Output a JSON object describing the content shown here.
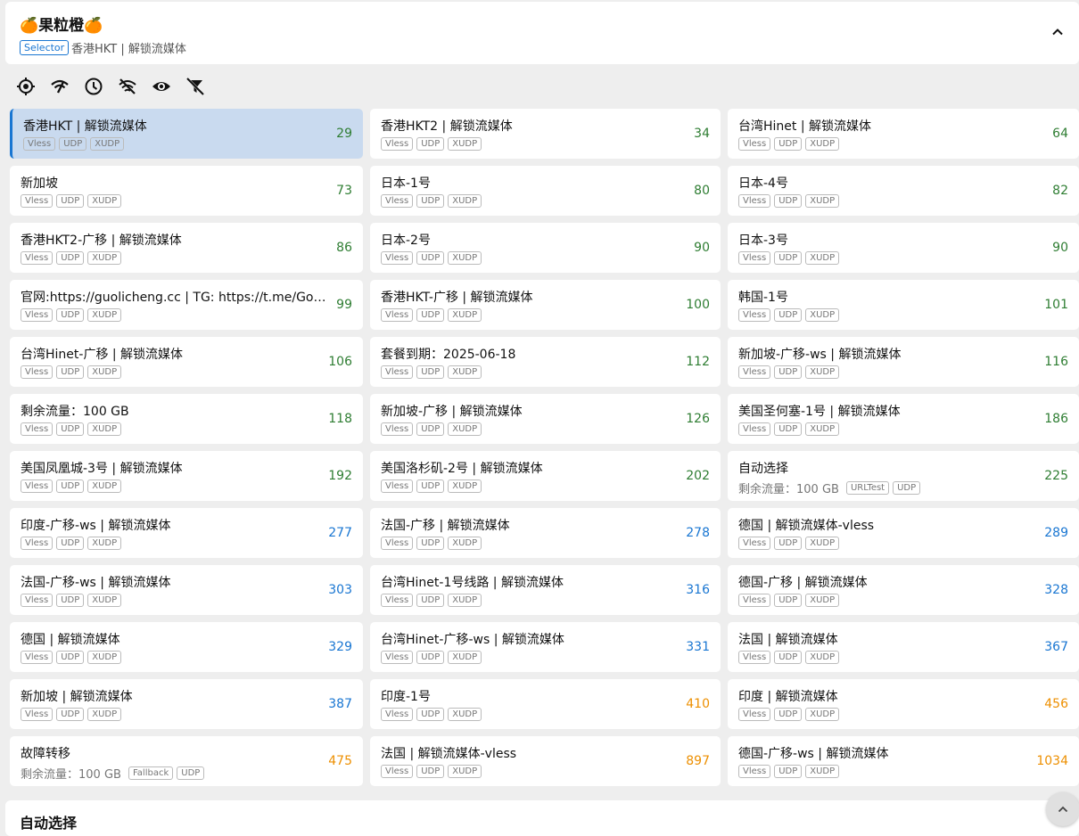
{
  "group": {
    "title": "🍊果粒橙🍊",
    "type_badge": "Selector",
    "current": "香港HKT | 解锁流媒体"
  },
  "toolbar": {
    "icons": [
      "locate-icon",
      "network-check-icon",
      "clock-sort-icon",
      "wifi-off-icon",
      "eye-icon",
      "filter-off-icon"
    ]
  },
  "colors": {
    "good": "#2e7d32",
    "medium": "#1976d2",
    "slow": "#ed8f00",
    "accent": "#1976d2"
  },
  "proxies": [
    {
      "name": "香港HKT | 解锁流媒体",
      "tags": [
        "Vless",
        "UDP",
        "XUDP"
      ],
      "delay": "29",
      "level": "good",
      "selected": true
    },
    {
      "name": "香港HKT2 | 解锁流媒体",
      "tags": [
        "Vless",
        "UDP",
        "XUDP"
      ],
      "delay": "34",
      "level": "good"
    },
    {
      "name": "台湾Hinet | 解锁流媒体",
      "tags": [
        "Vless",
        "UDP",
        "XUDP"
      ],
      "delay": "64",
      "level": "good"
    },
    {
      "name": "新加坡",
      "tags": [
        "Vless",
        "UDP",
        "XUDP"
      ],
      "delay": "73",
      "level": "good"
    },
    {
      "name": "日本-1号",
      "tags": [
        "Vless",
        "UDP",
        "XUDP"
      ],
      "delay": "80",
      "level": "good"
    },
    {
      "name": "日本-4号",
      "tags": [
        "Vless",
        "UDP",
        "XUDP"
      ],
      "delay": "82",
      "level": "good"
    },
    {
      "name": "香港HKT2-广移 | 解锁流媒体",
      "tags": [
        "Vless",
        "UDP",
        "XUDP"
      ],
      "delay": "86",
      "level": "good"
    },
    {
      "name": "日本-2号",
      "tags": [
        "Vless",
        "UDP",
        "XUDP"
      ],
      "delay": "90",
      "level": "good"
    },
    {
      "name": "日本-3号",
      "tags": [
        "Vless",
        "UDP",
        "XUDP"
      ],
      "delay": "90",
      "level": "good"
    },
    {
      "name": "官网:https://guolicheng.cc | TG: https://t.me/Gogu...",
      "tags": [
        "Vless",
        "UDP",
        "XUDP"
      ],
      "delay": "99",
      "level": "good"
    },
    {
      "name": "香港HKT-广移 | 解锁流媒体",
      "tags": [
        "Vless",
        "UDP",
        "XUDP"
      ],
      "delay": "100",
      "level": "good"
    },
    {
      "name": "韩国-1号",
      "tags": [
        "Vless",
        "UDP",
        "XUDP"
      ],
      "delay": "101",
      "level": "good"
    },
    {
      "name": "台湾Hinet-广移 | 解锁流媒体",
      "tags": [
        "Vless",
        "UDP",
        "XUDP"
      ],
      "delay": "106",
      "level": "good"
    },
    {
      "name": "套餐到期：2025-06-18",
      "tags": [
        "Vless",
        "UDP",
        "XUDP"
      ],
      "delay": "112",
      "level": "good"
    },
    {
      "name": "新加坡-广移-ws | 解锁流媒体",
      "tags": [
        "Vless",
        "UDP",
        "XUDP"
      ],
      "delay": "116",
      "level": "good"
    },
    {
      "name": "剩余流量：100 GB",
      "tags": [
        "Vless",
        "UDP",
        "XUDP"
      ],
      "delay": "118",
      "level": "good"
    },
    {
      "name": "新加坡-广移 | 解锁流媒体",
      "tags": [
        "Vless",
        "UDP",
        "XUDP"
      ],
      "delay": "126",
      "level": "good"
    },
    {
      "name": "美国圣何塞-1号 | 解锁流媒体",
      "tags": [
        "Vless",
        "UDP",
        "XUDP"
      ],
      "delay": "186",
      "level": "good"
    },
    {
      "name": "美国凤凰城-3号 | 解锁流媒体",
      "tags": [
        "Vless",
        "UDP",
        "XUDP"
      ],
      "delay": "192",
      "level": "good"
    },
    {
      "name": "美国洛杉矶-2号 | 解锁流媒体",
      "tags": [
        "Vless",
        "UDP",
        "XUDP"
      ],
      "delay": "202",
      "level": "good"
    },
    {
      "name": "自动选择",
      "subtext": "剩余流量：100 GB",
      "tags": [
        "URLTest",
        "UDP"
      ],
      "delay": "225",
      "level": "good"
    },
    {
      "name": "印度-广移-ws | 解锁流媒体",
      "tags": [
        "Vless",
        "UDP",
        "XUDP"
      ],
      "delay": "277",
      "level": "medium"
    },
    {
      "name": "法国-广移 | 解锁流媒体",
      "tags": [
        "Vless",
        "UDP",
        "XUDP"
      ],
      "delay": "278",
      "level": "medium"
    },
    {
      "name": "德国 | 解锁流媒体-vless",
      "tags": [
        "Vless",
        "UDP",
        "XUDP"
      ],
      "delay": "289",
      "level": "medium"
    },
    {
      "name": "法国-广移-ws | 解锁流媒体",
      "tags": [
        "Vless",
        "UDP",
        "XUDP"
      ],
      "delay": "303",
      "level": "medium"
    },
    {
      "name": "台湾Hinet-1号线路 | 解锁流媒体",
      "tags": [
        "Vless",
        "UDP",
        "XUDP"
      ],
      "delay": "316",
      "level": "medium"
    },
    {
      "name": "德国-广移 | 解锁流媒体",
      "tags": [
        "Vless",
        "UDP",
        "XUDP"
      ],
      "delay": "328",
      "level": "medium"
    },
    {
      "name": "德国 | 解锁流媒体",
      "tags": [
        "Vless",
        "UDP",
        "XUDP"
      ],
      "delay": "329",
      "level": "medium"
    },
    {
      "name": "台湾Hinet-广移-ws | 解锁流媒体",
      "tags": [
        "Vless",
        "UDP",
        "XUDP"
      ],
      "delay": "331",
      "level": "medium"
    },
    {
      "name": "法国 | 解锁流媒体",
      "tags": [
        "Vless",
        "UDP",
        "XUDP"
      ],
      "delay": "367",
      "level": "medium"
    },
    {
      "name": "新加坡 | 解锁流媒体",
      "tags": [
        "Vless",
        "UDP",
        "XUDP"
      ],
      "delay": "387",
      "level": "medium"
    },
    {
      "name": "印度-1号",
      "tags": [
        "Vless",
        "UDP",
        "XUDP"
      ],
      "delay": "410",
      "level": "slow"
    },
    {
      "name": "印度 | 解锁流媒体",
      "tags": [
        "Vless",
        "UDP",
        "XUDP"
      ],
      "delay": "456",
      "level": "slow"
    },
    {
      "name": "故障转移",
      "subtext": "剩余流量：100 GB",
      "tags": [
        "Fallback",
        "UDP"
      ],
      "delay": "475",
      "level": "slow"
    },
    {
      "name": "法国 | 解锁流媒体-vless",
      "tags": [
        "Vless",
        "UDP",
        "XUDP"
      ],
      "delay": "897",
      "level": "slow"
    },
    {
      "name": "德国-广移-ws | 解锁流媒体",
      "tags": [
        "Vless",
        "UDP",
        "XUDP"
      ],
      "delay": "1034",
      "level": "slow"
    }
  ],
  "next_group": {
    "title": "自动选择"
  }
}
